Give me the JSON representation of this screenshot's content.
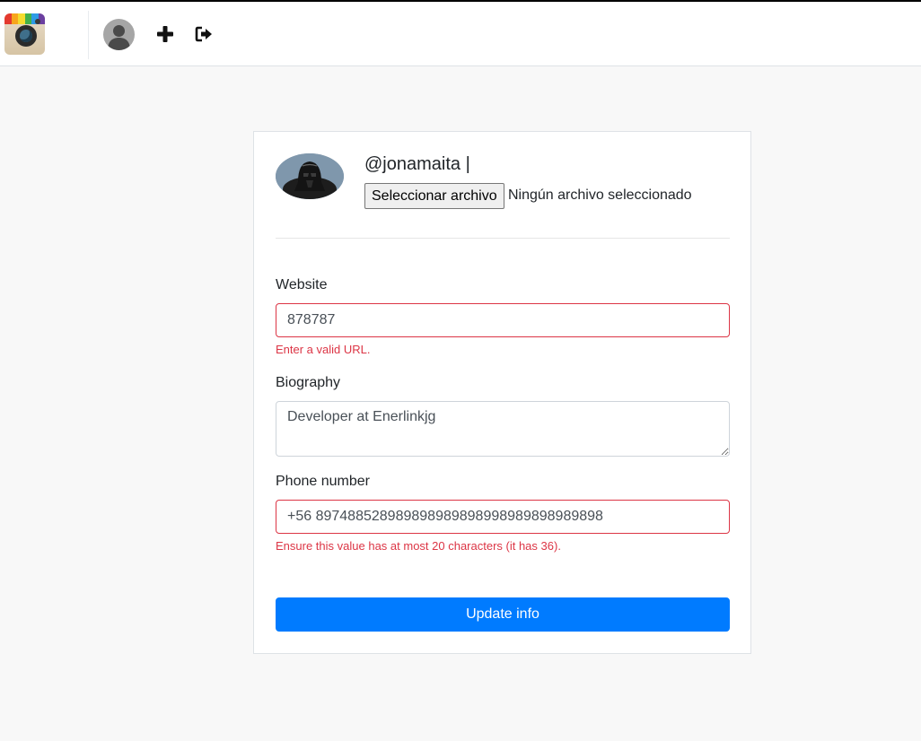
{
  "header": {
    "logo_icon": "instagram-camera-logo",
    "profile_icon": "user-avatar-icon",
    "add_icon": "plus-icon",
    "logout_icon": "sign-out-icon",
    "logo_stripe_colors": [
      "#e43a2f",
      "#f7a51c",
      "#f4dc2e",
      "#43b04a",
      "#2e9be6",
      "#6b3fa0"
    ]
  },
  "profile": {
    "username": "@jonamaita |",
    "picture_icon": "darth-vader-avatar",
    "file_button_label": "Seleccionar archivo",
    "file_status": "Ningún archivo seleccionado"
  },
  "form": {
    "website": {
      "label": "Website",
      "value": "878787",
      "error": "Enter a valid URL."
    },
    "biography": {
      "label": "Biography",
      "value": "Developer at Enerlinkjg"
    },
    "phone": {
      "label": "Phone number",
      "value": "+56 897488528989898989898998989898989898",
      "error": "Ensure this value has at most 20 characters (it has 36)."
    },
    "submit_label": "Update info"
  },
  "colors": {
    "accent": "#007bff",
    "error": "#dc3545",
    "page_background": "#f8f8f8"
  }
}
